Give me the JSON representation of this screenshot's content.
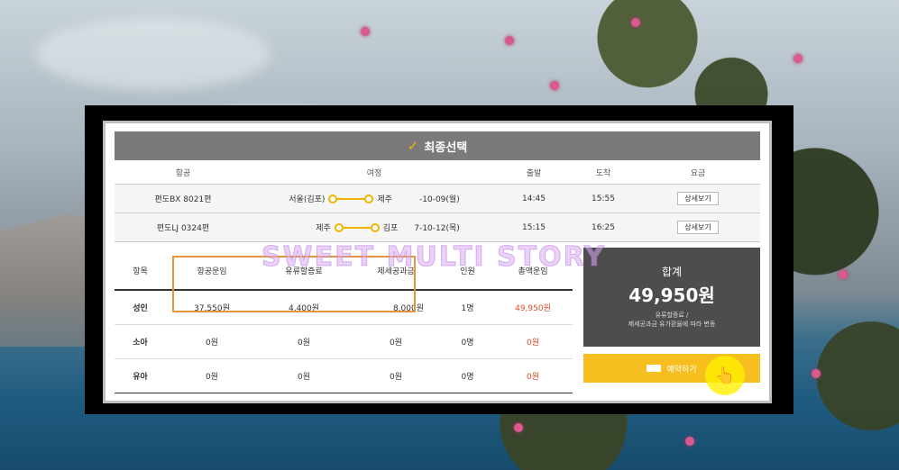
{
  "title": "최종선택",
  "flights": {
    "headers": [
      "항공",
      "여정",
      "출발",
      "도착",
      "요금"
    ],
    "rows": [
      {
        "flight": "편도BX 8021편",
        "from": "서울(김포)",
        "to": "제주",
        "date": "-10-09(월)",
        "depart": "14:45",
        "arrive": "15:55",
        "action": "상세보기"
      },
      {
        "flight": "편도LJ 0324편",
        "from": "제주",
        "to": "김포",
        "date": "7-10-12(목)",
        "depart": "15:15",
        "arrive": "16:25",
        "action": "상세보기"
      }
    ]
  },
  "fares": {
    "headers": [
      "항목",
      "항공운임",
      "유류할증료",
      "제세공과금",
      "인원",
      "총액운임"
    ],
    "rows": [
      {
        "type": "성인",
        "fare": "37,550원",
        "fuel": "4,400원",
        "tax": "8,000원",
        "count": "1명",
        "total": "49,950원"
      },
      {
        "type": "소아",
        "fare": "0원",
        "fuel": "0원",
        "tax": "0원",
        "count": "0명",
        "total": "0원"
      },
      {
        "type": "유아",
        "fare": "0원",
        "fuel": "0원",
        "tax": "0원",
        "count": "0명",
        "total": "0원"
      }
    ]
  },
  "summary": {
    "label": "합계",
    "amount": "49,950원",
    "note_line1": "유류할증료 /",
    "note_line2": "제세공과금 유가환율에 따라 변동"
  },
  "reserve_label": "예약하기",
  "watermark": "SWEET MULTI STORY",
  "colors": {
    "accent": "#f6be1f",
    "highlight": "#e8943a",
    "price": "#d94a2f"
  }
}
